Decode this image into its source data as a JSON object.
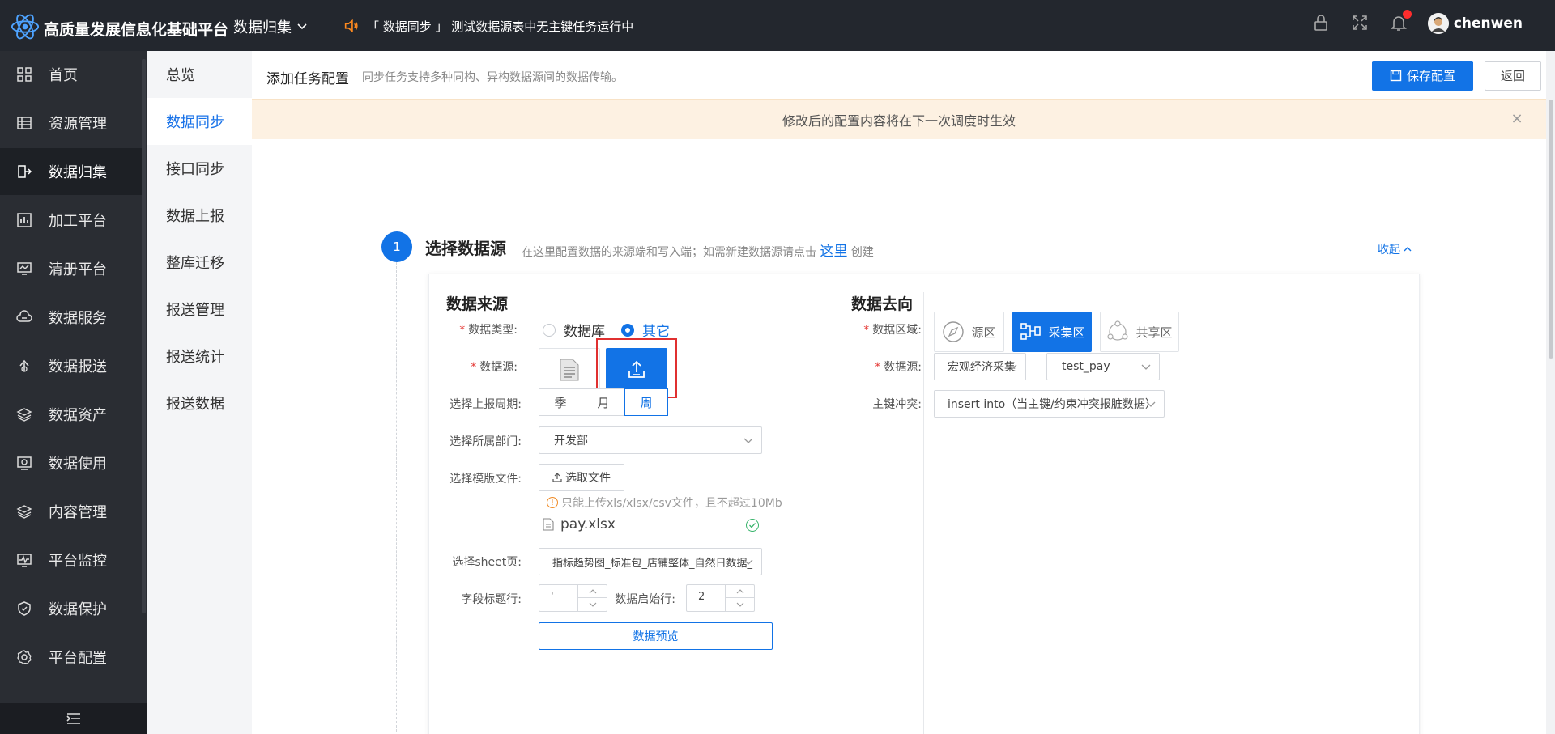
{
  "app": {
    "title": "高质量发展信息化基础平台",
    "module": "数据归集",
    "notice": "「 数据同步 」 测试数据源表中无主键任务运行中",
    "user": "chenwen"
  },
  "sidebar": {
    "items": [
      {
        "label": "首页",
        "icon": "home-icon"
      },
      {
        "label": "资源管理",
        "icon": "table-icon"
      },
      {
        "label": "数据归集",
        "icon": "collect-icon"
      },
      {
        "label": "加工平台",
        "icon": "chart-icon"
      },
      {
        "label": "清册平台",
        "icon": "monitor-icon"
      },
      {
        "label": "数据服务",
        "icon": "cloud-icon"
      },
      {
        "label": "数据报送",
        "icon": "upload-icon"
      },
      {
        "label": "数据资产",
        "icon": "layers-icon"
      },
      {
        "label": "数据使用",
        "icon": "screen-icon"
      },
      {
        "label": "内容管理",
        "icon": "layers2-icon"
      },
      {
        "label": "平台监控",
        "icon": "pulse-icon"
      },
      {
        "label": "数据保护",
        "icon": "shield-icon"
      },
      {
        "label": "平台配置",
        "icon": "gear-icon"
      }
    ],
    "active_index": 2
  },
  "submenu": {
    "items": [
      "总览",
      "数据同步",
      "接口同步",
      "数据上报",
      "整库迁移",
      "报送管理",
      "报送统计",
      "报送数据"
    ],
    "active_index": 1
  },
  "header": {
    "title": "添加任务配置",
    "subtitle": "同步任务支持多种同构、异构数据源间的数据传输。",
    "save_label": "保存配置",
    "back_label": "返回"
  },
  "alert": {
    "text": "修改后的配置内容将在下一次调度时生效",
    "close": "×"
  },
  "step": {
    "number": "1",
    "title": "选择数据源",
    "desc_before": "在这里配置数据的来源端和写入端；如需新建数据源请点击",
    "desc_link": "这里",
    "desc_after": "创建",
    "collapse_label": "收起"
  },
  "source": {
    "title": "数据来源",
    "type_label": "数据类型:",
    "type_options": [
      "数据库",
      "其它"
    ],
    "type_selected": "其它",
    "ds_label": "数据源:",
    "period_label": "选择上报周期:",
    "period_options": [
      "季",
      "月",
      "周"
    ],
    "period_selected": "周",
    "dept_label": "选择所属部门:",
    "dept_value": "开发部",
    "template_label": "选择模版文件:",
    "choose_file": "选取文件",
    "file_hint": "只能上传xls/xlsx/csv文件，且不超过10Mb",
    "file_name": "pay.xlsx",
    "sheet_label": "选择sheet页:",
    "sheet_value": "指标趋势图_标准包_店铺整体_自然日数据_",
    "title_row_label": "字段标题行:",
    "title_row_value": "'",
    "start_row_label": "数据启始行:",
    "start_row_value": "2",
    "preview_label": "数据预览"
  },
  "target": {
    "title": "数据去向",
    "zone_label": "数据区域:",
    "zones": [
      {
        "label": "源区",
        "icon": "compass-icon"
      },
      {
        "label": "采集区",
        "icon": "collect-zone-icon"
      },
      {
        "label": "共享区",
        "icon": "share-icon"
      }
    ],
    "zone_selected": "采集区",
    "ds_label": "数据源:",
    "ds_value": "宏观经济采集",
    "table_value": "test_pay",
    "conflict_label": "主键冲突:",
    "conflict_value": "insert into（当主键/约束冲突报脏数据）"
  },
  "colors": {
    "primary": "#1273e6",
    "topbar": "#23272e",
    "sidebar": "#2a2d33",
    "alert_bg": "#fdf1e2",
    "highlight": "#e03030"
  }
}
